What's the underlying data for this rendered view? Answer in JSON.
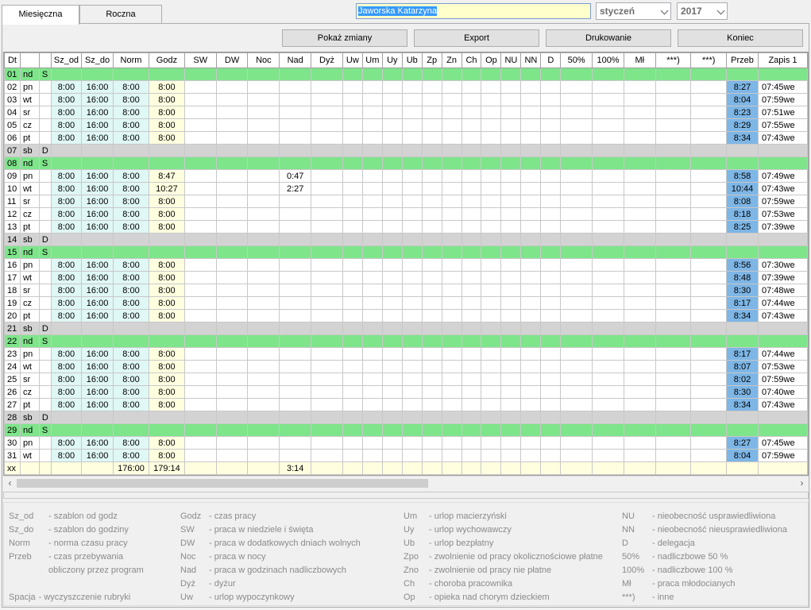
{
  "tabs": [
    {
      "label": "Miesięczna",
      "active": true
    },
    {
      "label": "Roczna",
      "active": false
    }
  ],
  "employee_name": "Jaworska Katarzyna",
  "month_select": "styczeń",
  "year_select": "2017",
  "buttons": {
    "show_changes": "Pokaż zmiany",
    "export": "Export",
    "print": "Drukowanie",
    "end": "Koniec"
  },
  "columns": [
    "Dt",
    "",
    "",
    "Sz_od",
    "Sz_do",
    "Norm",
    "Godz",
    "SW",
    "DW",
    "Noc",
    "Nad",
    "Dyż",
    "Uw",
    "Um",
    "Uy",
    "Ub",
    "Zp",
    "Zn",
    "Ch",
    "Op",
    "NU",
    "NN",
    "D",
    "50%",
    "100%",
    "Mł",
    "***)",
    "***)",
    "Przeb",
    "Zapis 1"
  ],
  "rows": [
    {
      "dt": "01",
      "dw": "nd",
      "fl": "S",
      "type": "sun",
      "od": "",
      "do": "",
      "nm": "",
      "gz": "",
      "nad": "",
      "pz": "",
      "zp": ""
    },
    {
      "dt": "02",
      "dw": "pn",
      "fl": "",
      "type": "wk",
      "od": "8:00",
      "do": "16:00",
      "nm": "8:00",
      "gz": "8:00",
      "nad": "",
      "pz": "8:27",
      "zp": "07:45we"
    },
    {
      "dt": "03",
      "dw": "wt",
      "fl": "",
      "type": "wk",
      "od": "8:00",
      "do": "16:00",
      "nm": "8:00",
      "gz": "8:00",
      "nad": "",
      "pz": "8:04",
      "zp": "07:59we"
    },
    {
      "dt": "04",
      "dw": "sr",
      "fl": "",
      "type": "wk",
      "od": "8:00",
      "do": "16:00",
      "nm": "8:00",
      "gz": "8:00",
      "nad": "",
      "pz": "8:23",
      "zp": "07:51we"
    },
    {
      "dt": "05",
      "dw": "cz",
      "fl": "",
      "type": "wk",
      "od": "8:00",
      "do": "16:00",
      "nm": "8:00",
      "gz": "8:00",
      "nad": "",
      "pz": "8:29",
      "zp": "07:55we"
    },
    {
      "dt": "06",
      "dw": "pt",
      "fl": "",
      "type": "wk",
      "od": "8:00",
      "do": "16:00",
      "nm": "8:00",
      "gz": "8:00",
      "nad": "",
      "pz": "8:34",
      "zp": "07:43we"
    },
    {
      "dt": "07",
      "dw": "sb",
      "fl": "D",
      "type": "sat",
      "od": "",
      "do": "",
      "nm": "",
      "gz": "",
      "nad": "",
      "pz": "",
      "zp": ""
    },
    {
      "dt": "08",
      "dw": "nd",
      "fl": "S",
      "type": "sun",
      "od": "",
      "do": "",
      "nm": "",
      "gz": "",
      "nad": "",
      "pz": "",
      "zp": ""
    },
    {
      "dt": "09",
      "dw": "pn",
      "fl": "",
      "type": "wk",
      "od": "8:00",
      "do": "16:00",
      "nm": "8:00",
      "gz": "8:47",
      "nad": "0:47",
      "pz": "8:58",
      "zp": "07:49we"
    },
    {
      "dt": "10",
      "dw": "wt",
      "fl": "",
      "type": "wk",
      "od": "8:00",
      "do": "16:00",
      "nm": "8:00",
      "gz": "10:27",
      "nad": "2:27",
      "pz": "10:44",
      "zp": "07:43we"
    },
    {
      "dt": "11",
      "dw": "sr",
      "fl": "",
      "type": "wk",
      "od": "8:00",
      "do": "16:00",
      "nm": "8:00",
      "gz": "8:00",
      "nad": "",
      "pz": "8:08",
      "zp": "07:59we"
    },
    {
      "dt": "12",
      "dw": "cz",
      "fl": "",
      "type": "wk",
      "od": "8:00",
      "do": "16:00",
      "nm": "8:00",
      "gz": "8:00",
      "nad": "",
      "pz": "8:18",
      "zp": "07:53we"
    },
    {
      "dt": "13",
      "dw": "pt",
      "fl": "",
      "type": "wk",
      "od": "8:00",
      "do": "16:00",
      "nm": "8:00",
      "gz": "8:00",
      "nad": "",
      "pz": "8:25",
      "zp": "07:39we"
    },
    {
      "dt": "14",
      "dw": "sb",
      "fl": "D",
      "type": "sat",
      "od": "",
      "do": "",
      "nm": "",
      "gz": "",
      "nad": "",
      "pz": "",
      "zp": ""
    },
    {
      "dt": "15",
      "dw": "nd",
      "fl": "S",
      "type": "sun",
      "od": "",
      "do": "",
      "nm": "",
      "gz": "",
      "nad": "",
      "pz": "",
      "zp": ""
    },
    {
      "dt": "16",
      "dw": "pn",
      "fl": "",
      "type": "wk",
      "od": "8:00",
      "do": "16:00",
      "nm": "8:00",
      "gz": "8:00",
      "nad": "",
      "pz": "8:56",
      "zp": "07:30we"
    },
    {
      "dt": "17",
      "dw": "wt",
      "fl": "",
      "type": "wk",
      "od": "8:00",
      "do": "16:00",
      "nm": "8:00",
      "gz": "8:00",
      "nad": "",
      "pz": "8:48",
      "zp": "07:39we"
    },
    {
      "dt": "18",
      "dw": "sr",
      "fl": "",
      "type": "wk",
      "od": "8:00",
      "do": "16:00",
      "nm": "8:00",
      "gz": "8:00",
      "nad": "",
      "pz": "8:30",
      "zp": "07:48we"
    },
    {
      "dt": "19",
      "dw": "cz",
      "fl": "",
      "type": "wk",
      "od": "8:00",
      "do": "16:00",
      "nm": "8:00",
      "gz": "8:00",
      "nad": "",
      "pz": "8:17",
      "zp": "07:44we"
    },
    {
      "dt": "20",
      "dw": "pt",
      "fl": "",
      "type": "wk",
      "od": "8:00",
      "do": "16:00",
      "nm": "8:00",
      "gz": "8:00",
      "nad": "",
      "pz": "8:34",
      "zp": "07:43we"
    },
    {
      "dt": "21",
      "dw": "sb",
      "fl": "D",
      "type": "sat",
      "od": "",
      "do": "",
      "nm": "",
      "gz": "",
      "nad": "",
      "pz": "",
      "zp": ""
    },
    {
      "dt": "22",
      "dw": "nd",
      "fl": "S",
      "type": "sun",
      "od": "",
      "do": "",
      "nm": "",
      "gz": "",
      "nad": "",
      "pz": "",
      "zp": ""
    },
    {
      "dt": "23",
      "dw": "pn",
      "fl": "",
      "type": "wk",
      "od": "8:00",
      "do": "16:00",
      "nm": "8:00",
      "gz": "8:00",
      "nad": "",
      "pz": "8:17",
      "zp": "07:44we"
    },
    {
      "dt": "24",
      "dw": "wt",
      "fl": "",
      "type": "wk",
      "od": "8:00",
      "do": "16:00",
      "nm": "8:00",
      "gz": "8:00",
      "nad": "",
      "pz": "8:07",
      "zp": "07:53we"
    },
    {
      "dt": "25",
      "dw": "sr",
      "fl": "",
      "type": "wk",
      "od": "8:00",
      "do": "16:00",
      "nm": "8:00",
      "gz": "8:00",
      "nad": "",
      "pz": "8:02",
      "zp": "07:59we"
    },
    {
      "dt": "26",
      "dw": "cz",
      "fl": "",
      "type": "wk",
      "od": "8:00",
      "do": "16:00",
      "nm": "8:00",
      "gz": "8:00",
      "nad": "",
      "pz": "8:30",
      "zp": "07:40we"
    },
    {
      "dt": "27",
      "dw": "pt",
      "fl": "",
      "type": "wk",
      "od": "8:00",
      "do": "16:00",
      "nm": "8:00",
      "gz": "8:00",
      "nad": "",
      "pz": "8:34",
      "zp": "07:43we"
    },
    {
      "dt": "28",
      "dw": "sb",
      "fl": "D",
      "type": "sat",
      "od": "",
      "do": "",
      "nm": "",
      "gz": "",
      "nad": "",
      "pz": "",
      "zp": ""
    },
    {
      "dt": "29",
      "dw": "nd",
      "fl": "S",
      "type": "sun",
      "od": "",
      "do": "",
      "nm": "",
      "gz": "",
      "nad": "",
      "pz": "",
      "zp": ""
    },
    {
      "dt": "30",
      "dw": "pn",
      "fl": "",
      "type": "wk",
      "od": "8:00",
      "do": "16:00",
      "nm": "8:00",
      "gz": "8:00",
      "nad": "",
      "pz": "8:27",
      "zp": "07:45we"
    },
    {
      "dt": "31",
      "dw": "wt",
      "fl": "",
      "type": "wk",
      "od": "8:00",
      "do": "16:00",
      "nm": "8:00",
      "gz": "8:00",
      "nad": "",
      "pz": "8:04",
      "zp": "07:59we"
    }
  ],
  "totals": {
    "dt": "xx",
    "nm": "176:00",
    "gz": "179:14",
    "nad": "3:14"
  },
  "legend": [
    {
      "k": "Sz_od",
      "v": "- szablon od godz"
    },
    {
      "k": "Sz_do",
      "v": "- szablon do godziny"
    },
    {
      "k": "Norm",
      "v": "- norma czasu pracy"
    },
    {
      "k": "Przeb",
      "v": "- czas przebywania"
    },
    {
      "k": "",
      "v": "obliczony przez program"
    },
    {
      "k": "Spacja",
      "v": "- wyczyszczenie rubryki"
    },
    {
      "k": "Godz",
      "v": "- czas pracy"
    },
    {
      "k": "SW",
      "v": "- praca w niedziele i święta"
    },
    {
      "k": "DW",
      "v": "- praca w dodatkowych dniach wolnych"
    },
    {
      "k": "Noc",
      "v": "- praca w nocy"
    },
    {
      "k": "Nad",
      "v": "- praca w godzinach nadliczbowych"
    },
    {
      "k": "Dyż",
      "v": "- dyżur"
    },
    {
      "k": "Uw",
      "v": "- urlop wypoczynkowy"
    },
    {
      "k": "Um",
      "v": "- urlop macierzyński"
    },
    {
      "k": "Uy",
      "v": "- urlop wychowawczy"
    },
    {
      "k": "Ub",
      "v": "- urlop bezpłatny"
    },
    {
      "k": "Zpo",
      "v": "- zwolnienie od pracy okolicznościowe płatne"
    },
    {
      "k": "Zno",
      "v": "- zwolnienie od pracy nie płatne"
    },
    {
      "k": "Ch",
      "v": "- choroba pracownika"
    },
    {
      "k": "Op",
      "v": "- opieka nad chorym dzieckiem"
    },
    {
      "k": "NU",
      "v": "- nieobecność usprawiedliwiona"
    },
    {
      "k": "NN",
      "v": "- nieobecność nieusprawiedliwiona"
    },
    {
      "k": "D",
      "v": "- delegacja"
    },
    {
      "k": "50%",
      "v": "- nadliczbowe 50 %"
    },
    {
      "k": "100%",
      "v": "- nadliczbowe 100 %"
    },
    {
      "k": "Mł",
      "v": "- praca młodocianych"
    },
    {
      "k": "***)",
      "v": "- inne"
    }
  ],
  "colors": {
    "sunday": "#7ee58a",
    "saturday": "#d3d3d3",
    "przeb": "#7eb6e6",
    "godz": "#ffffe0",
    "template": "#dff7f5"
  }
}
